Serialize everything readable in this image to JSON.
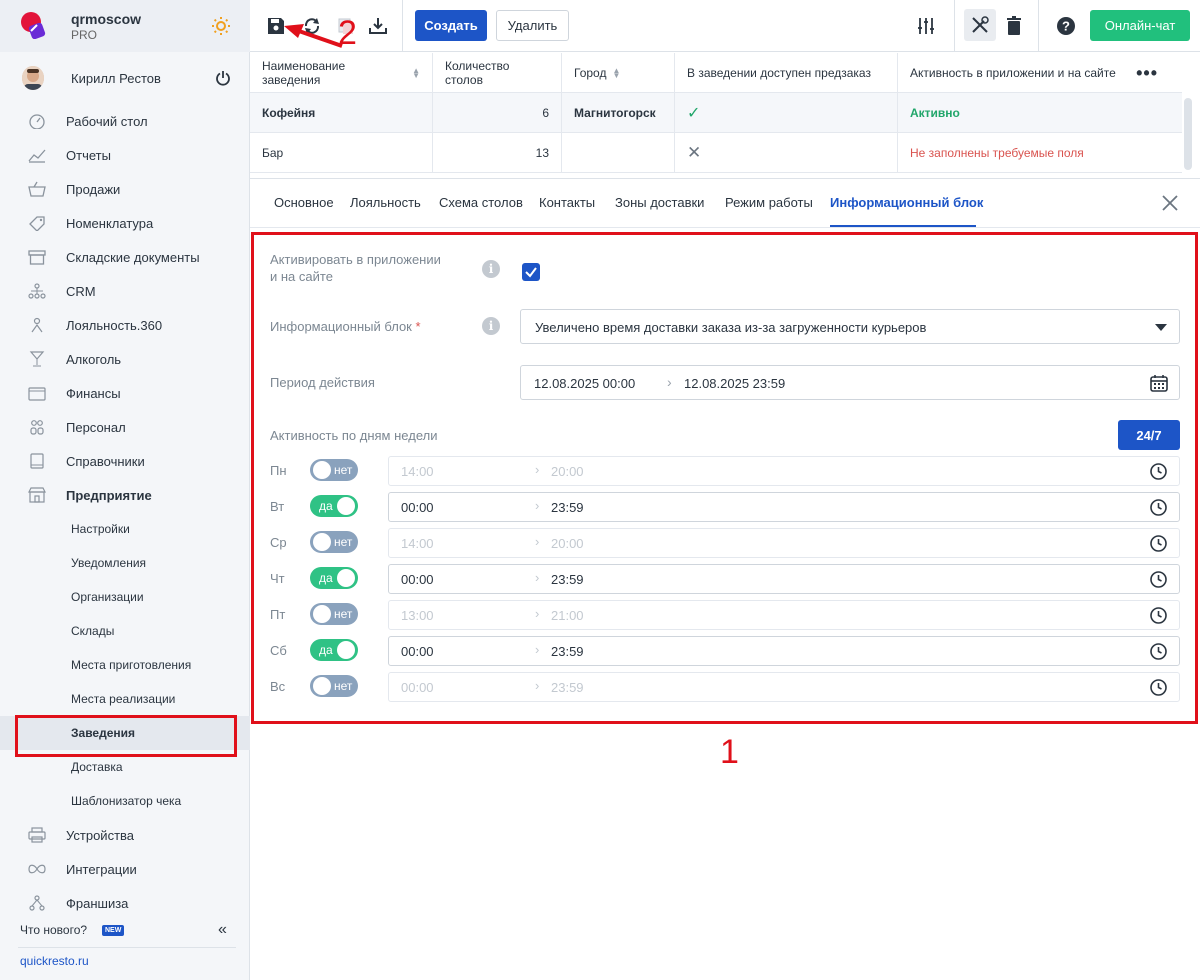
{
  "brand": {
    "name": "qrmoscow",
    "plan": "PRO"
  },
  "user": {
    "name": "Кирилл Рестов"
  },
  "nav": {
    "items": [
      {
        "label": "Рабочий стол"
      },
      {
        "label": "Отчеты"
      },
      {
        "label": "Продажи"
      },
      {
        "label": "Номенклатура"
      },
      {
        "label": "Складские документы"
      },
      {
        "label": "CRM"
      },
      {
        "label": "Лояльность.360"
      },
      {
        "label": "Алкоголь"
      },
      {
        "label": "Финансы"
      },
      {
        "label": "Персонал"
      },
      {
        "label": "Справочники"
      },
      {
        "label": "Предприятие"
      }
    ],
    "sub": [
      {
        "label": "Настройки"
      },
      {
        "label": "Уведомления"
      },
      {
        "label": "Организации"
      },
      {
        "label": "Склады"
      },
      {
        "label": "Места приготовления"
      },
      {
        "label": "Места реализации"
      },
      {
        "label": "Заведения"
      },
      {
        "label": "Доставка"
      },
      {
        "label": "Шаблонизатор чека"
      }
    ],
    "after": [
      {
        "label": "Устройства"
      },
      {
        "label": "Интеграции"
      },
      {
        "label": "Франшиза"
      }
    ],
    "whats_new": "Что нового?",
    "new_badge": "NEW",
    "site": "quickresto.ru"
  },
  "toolbar": {
    "create": "Создать",
    "delete": "Удалить",
    "chat": "Онлайн-чат"
  },
  "table": {
    "headers": [
      "Наименование заведения",
      "Количество столов",
      "Город",
      "В заведении доступен предзаказ",
      "Активность в приложении и на сайте"
    ],
    "rows": [
      {
        "name": "Кофейня",
        "tables": "6",
        "city": "Магнитогорск",
        "preorder": "✓",
        "status": "Активно"
      },
      {
        "name": "Бар",
        "tables": "13",
        "city": "",
        "preorder": "✕",
        "status": "Не заполнены требуемые поля"
      }
    ]
  },
  "tabs": [
    "Основное",
    "Лояльность",
    "Схема столов",
    "Контакты",
    "Зоны доставки",
    "Режим работы",
    "Информационный блок"
  ],
  "form": {
    "activate_label": "Активировать в приложении и на сайте",
    "activate_checked": true,
    "info_block_label": "Информационный блок",
    "required_mark": "*",
    "info_block_value": "Увеличено время доставки заказа из-за загруженности курьеров",
    "period_label": "Период действия",
    "period_from": "12.08.2025 00:00",
    "period_to": "12.08.2025 23:59",
    "week_label": "Активность по дням недели",
    "btn_247": "24/7",
    "days": [
      {
        "name": "Пн",
        "on": false,
        "toggle": "нет",
        "from": "14:00",
        "to": "20:00"
      },
      {
        "name": "Вт",
        "on": true,
        "toggle": "да",
        "from": "00:00",
        "to": "23:59"
      },
      {
        "name": "Ср",
        "on": false,
        "toggle": "нет",
        "from": "14:00",
        "to": "20:00"
      },
      {
        "name": "Чт",
        "on": true,
        "toggle": "да",
        "from": "00:00",
        "to": "23:59"
      },
      {
        "name": "Пт",
        "on": false,
        "toggle": "нет",
        "from": "13:00",
        "to": "21:00"
      },
      {
        "name": "Сб",
        "on": true,
        "toggle": "да",
        "from": "00:00",
        "to": "23:59"
      },
      {
        "name": "Вс",
        "on": false,
        "toggle": "нет",
        "from": "00:00",
        "to": "23:59"
      }
    ]
  },
  "annotations": {
    "one": "1",
    "two": "2"
  },
  "colors": {
    "accent": "#1d55c7",
    "success": "#21c07d",
    "highlight": "#e0101a"
  }
}
